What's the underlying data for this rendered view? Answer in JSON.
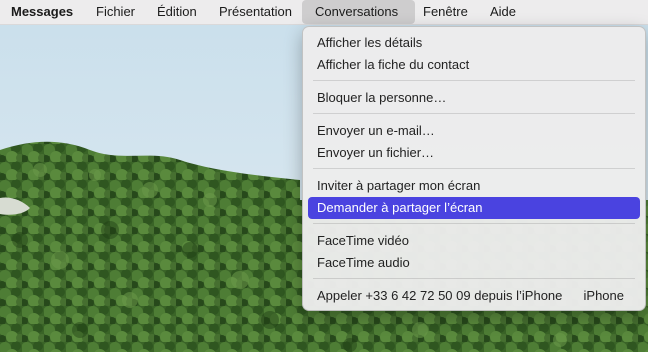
{
  "menubar": {
    "app_name": "Messages",
    "items": [
      "Fichier",
      "Édition",
      "Présentation",
      "Conversations",
      "Fenêtre",
      "Aide"
    ],
    "active_item": "Conversations"
  },
  "conversations_menu": {
    "items": [
      {
        "label": "Afficher les détails",
        "enabled": true
      },
      {
        "label": "Afficher la fiche du contact",
        "enabled": true
      },
      {
        "label": "Bloquer la personne…",
        "enabled": true
      },
      {
        "label": "Envoyer un e-mail…",
        "enabled": true
      },
      {
        "label": "Envoyer un fichier…",
        "enabled": true
      },
      {
        "label": "Inviter à partager mon écran",
        "enabled": true
      },
      {
        "label": "Demander à partager l’écran",
        "enabled": true,
        "highlighted": true
      },
      {
        "label": "FaceTime vidéo",
        "enabled": true
      },
      {
        "label": "FaceTime audio",
        "enabled": true
      },
      {
        "label": "Appeler +33 6 42 72 50 09 depuis l’iPhone",
        "shortcut": "iPhone",
        "enabled": true
      }
    ],
    "highlight_color": "#4a43e0"
  },
  "colors": {
    "menubar_bg": "#eeecec",
    "menu_bg": "#ececec",
    "sky": "#cfe3ef",
    "forest": "#3d6a2a"
  }
}
